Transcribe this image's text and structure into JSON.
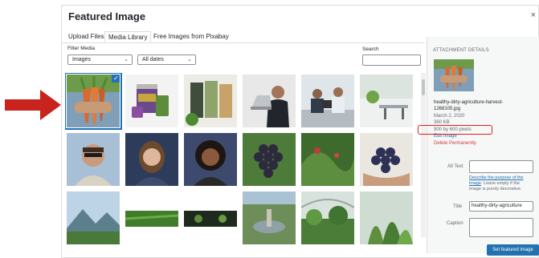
{
  "dialog": {
    "title": "Featured Image",
    "close": "×"
  },
  "tabs": [
    {
      "label": "Upload Files",
      "active": false
    },
    {
      "label": "Media Library",
      "active": true
    },
    {
      "label": "Free Images from Pixabay",
      "active": false
    }
  ],
  "filter": {
    "label": "Filter Media",
    "type_value": "Images",
    "date_value": "All dates",
    "chevron": "⌄"
  },
  "search": {
    "label": "Search",
    "value": ""
  },
  "grid": {
    "items": [
      {
        "desc": "carrots-held-in-hands",
        "selected": true
      },
      {
        "desc": "supplement-packages"
      },
      {
        "desc": "product-bags"
      },
      {
        "desc": "man-with-laptop"
      },
      {
        "desc": "office-workers"
      },
      {
        "desc": "office-space"
      },
      {
        "desc": "smiling-man-sunglasses"
      },
      {
        "desc": "smiling-woman"
      },
      {
        "desc": "smiling-woman-curly-hair"
      },
      {
        "desc": "grapes-bunch"
      },
      {
        "desc": "green-plants"
      },
      {
        "desc": "grapes-in-hands"
      },
      {
        "desc": "mountains-landscape"
      },
      {
        "desc": "green-banner"
      },
      {
        "desc": "dark-banner"
      },
      {
        "desc": "garden-fountain"
      },
      {
        "desc": "greenhouse"
      },
      {
        "desc": "tropical-plants"
      }
    ],
    "check": "✓"
  },
  "details": {
    "heading": "ATTACHMENT DETAILS",
    "filename_line1": "healthy-dirty-agriculture-harvest-",
    "filename_line2": "1268105.jpg",
    "date": "March 2, 2020",
    "size": "360 KB",
    "dimensions": "900 by 600 pixels",
    "edit": "Edit Image",
    "delete": "Delete Permanently"
  },
  "fields": {
    "alt_label": "Alt Text",
    "alt_value": "",
    "alt_desc_link1": "Describe the purpose of the",
    "alt_desc_link2": "image",
    "alt_desc_rest1": ". Leave empty if the",
    "alt_desc_rest2": "image is purely decorative.",
    "title_label": "Title",
    "title_value": "healthy-dirty-agriculture",
    "caption_label": "Caption",
    "caption_value": ""
  },
  "button": {
    "label": "Set featured image"
  },
  "colors": {
    "accent": "#2271b1",
    "highlight": "#e01b1b",
    "delete": "#d63638"
  }
}
